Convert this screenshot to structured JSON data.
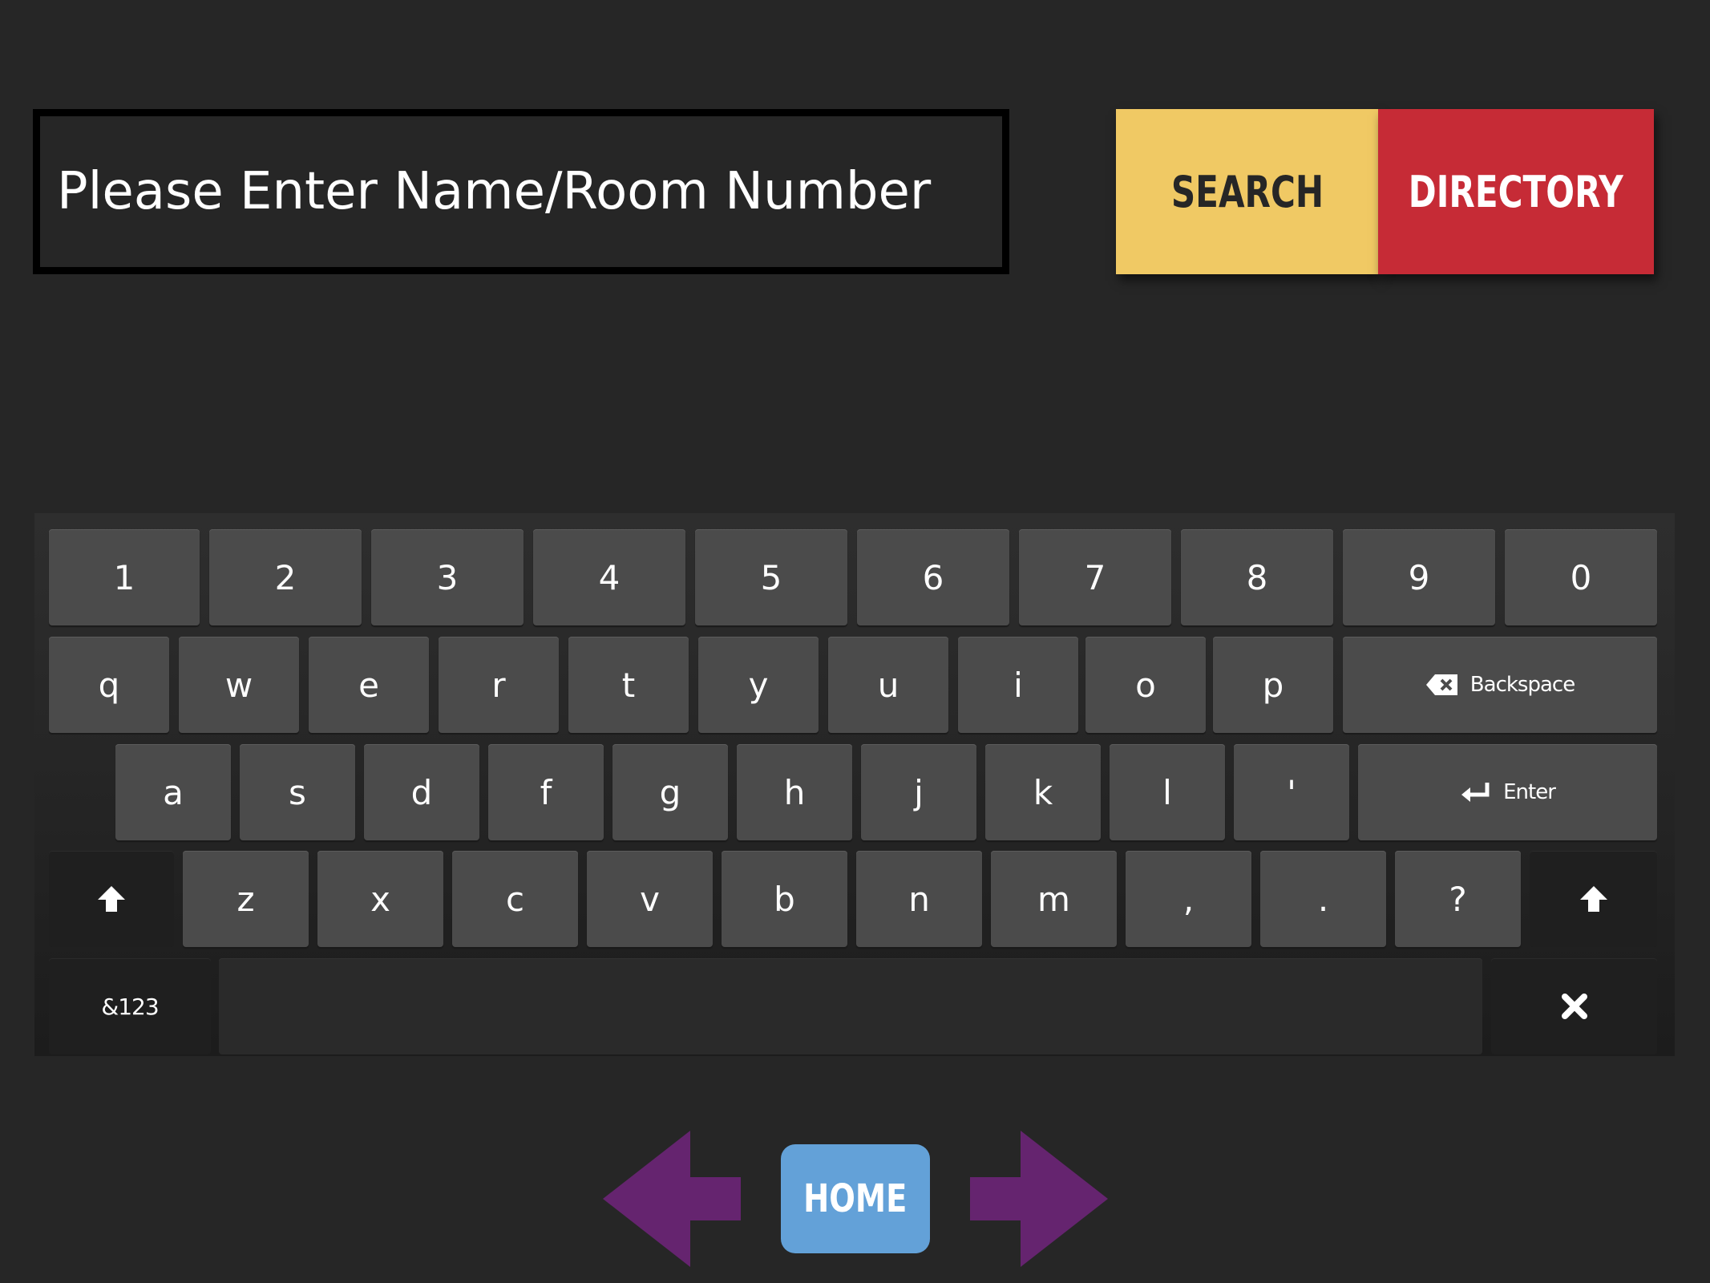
{
  "search": {
    "placeholder": "Please Enter Name/Room Number"
  },
  "buttons": {
    "search": "SEARCH",
    "directory": "DIRECTORY",
    "home": "HOME"
  },
  "colors": {
    "background": "#262626",
    "search_button": "#f0c964",
    "directory_button": "#c62b36",
    "home_button": "#63a1d8",
    "nav_arrows": "#65246f"
  },
  "keyboard": {
    "row1": [
      "1",
      "2",
      "3",
      "4",
      "5",
      "6",
      "7",
      "8",
      "9",
      "0"
    ],
    "row2": [
      "q",
      "w",
      "e",
      "r",
      "t",
      "y",
      "u",
      "i",
      "o",
      "p"
    ],
    "backspace_label": "Backspace",
    "row3": [
      "a",
      "s",
      "d",
      "f",
      "g",
      "h",
      "j",
      "k",
      "l",
      "'"
    ],
    "enter_label": "Enter",
    "row4": [
      "z",
      "x",
      "c",
      "v",
      "b",
      "n",
      "m",
      ",",
      ".",
      "?"
    ],
    "symbols_label": "&123"
  },
  "icons": {
    "back": "left-arrow-icon",
    "forward": "right-arrow-icon",
    "shift": "shift-up-arrow-icon",
    "close": "close-x-icon",
    "backspace": "backspace-icon",
    "enter": "enter-return-icon"
  }
}
